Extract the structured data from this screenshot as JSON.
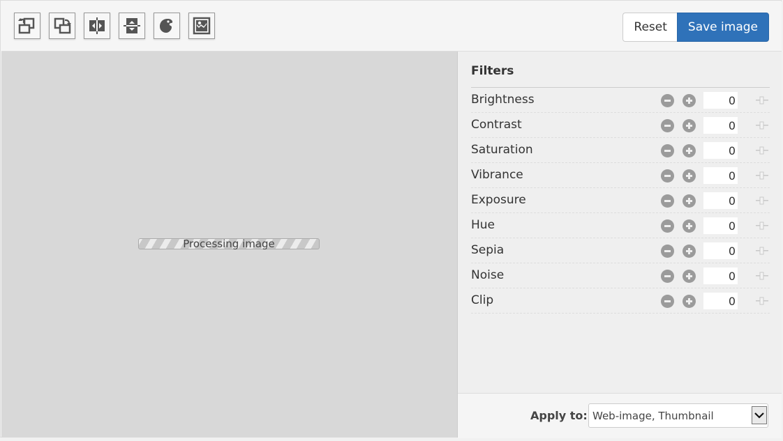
{
  "toolbar": {
    "tools": [
      {
        "name": "rotate-left",
        "label": "Rotate left"
      },
      {
        "name": "rotate-right",
        "label": "Rotate right"
      },
      {
        "name": "flip-horizontal",
        "label": "Flip horizontal"
      },
      {
        "name": "flip-vertical",
        "label": "Flip vertical"
      },
      {
        "name": "filters",
        "label": "Filters"
      },
      {
        "name": "image",
        "label": "Image"
      }
    ],
    "reset_label": "Reset",
    "save_label": "Save image"
  },
  "canvas": {
    "status_text": "Processing image"
  },
  "filters": {
    "title": "Filters",
    "items": [
      {
        "label": "Brightness",
        "value": "0"
      },
      {
        "label": "Contrast",
        "value": "0"
      },
      {
        "label": "Saturation",
        "value": "0"
      },
      {
        "label": "Vibrance",
        "value": "0"
      },
      {
        "label": "Exposure",
        "value": "0"
      },
      {
        "label": "Hue",
        "value": "0"
      },
      {
        "label": "Sepia",
        "value": "0"
      },
      {
        "label": "Noise",
        "value": "0"
      },
      {
        "label": "Clip",
        "value": "0"
      }
    ]
  },
  "footer": {
    "apply_label": "Apply to:",
    "apply_value": "Web-image, Thumbnail"
  },
  "colors": {
    "accent": "#2f72b9",
    "canvas_bg": "#d8d8d8",
    "icon_gray": "#9b9b9b"
  }
}
